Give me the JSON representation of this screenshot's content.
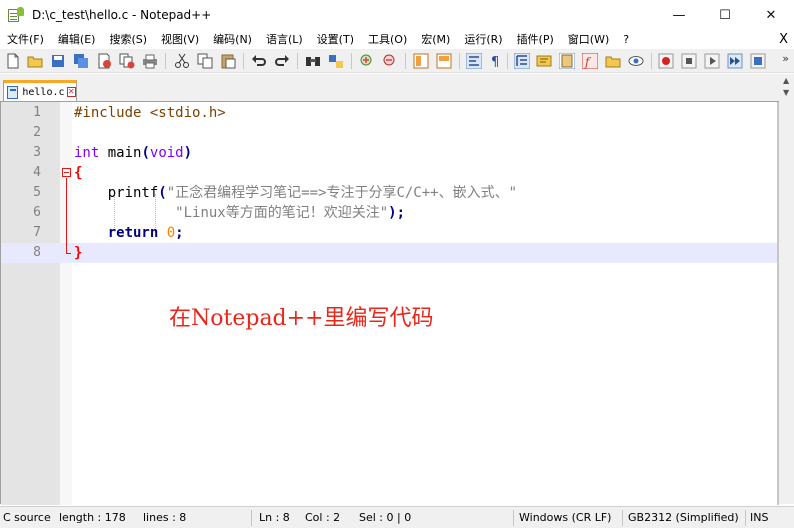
{
  "window": {
    "title": "D:\\c_test\\hello.c - Notepad++",
    "minimize_glyph": "—",
    "maximize_glyph": "☐",
    "close_glyph": "✕"
  },
  "menu": {
    "items": [
      "文件(F)",
      "编辑(E)",
      "搜索(S)",
      "视图(V)",
      "编码(N)",
      "语言(L)",
      "设置(T)",
      "工具(O)",
      "宏(M)",
      "运行(R)",
      "插件(P)",
      "窗口(W)",
      "?"
    ],
    "close_glyph": "X"
  },
  "toolbar": {
    "overflow_glyph": "»",
    "icons": [
      "new-file-icon",
      "open-file-icon",
      "save-icon",
      "save-all-icon",
      "close-icon",
      "close-all-icon",
      "print-icon",
      "cut-icon",
      "copy-icon",
      "paste-icon",
      "undo-icon",
      "redo-icon",
      "find-icon",
      "replace-icon",
      "zoom-in-icon",
      "zoom-out-icon",
      "sync-vertical-icon",
      "sync-horizontal-icon",
      "word-wrap-icon",
      "show-all-chars-icon",
      "indent-guide-icon",
      "udl-icon",
      "doc-map-icon",
      "function-list-icon",
      "folder-workspace-icon",
      "monitor-icon",
      "record-macro-icon",
      "stop-macro-icon",
      "play-macro-icon",
      "run-macro-multiple-icon",
      "save-macro-icon"
    ]
  },
  "tab": {
    "label": "hello.c",
    "close_glyph": "✕"
  },
  "editor": {
    "line_numbers": [
      "1",
      "2",
      "3",
      "4",
      "5",
      "6",
      "7",
      "8"
    ],
    "lines": {
      "l1_pp": "#include <stdio.h>",
      "l3_type": "int",
      "l3_name": " main",
      "l3_open": "(",
      "l3_void": "void",
      "l3_close": ")",
      "l4_brace": "{",
      "l5_indent": "    ",
      "l5_func": "printf",
      "l5_paren": "(",
      "l5_str": "\"正念君编程学习笔记==>专注于分享C/C++、嵌入式、\"",
      "l6_indent": "            ",
      "l6_str": "\"Linux等方面的笔记！欢迎关注\"",
      "l6_close": ");",
      "l7_indent": "    ",
      "l7_kw": "return",
      "l7_num": "0",
      "l7_semi": ";",
      "l8_brace": "}"
    },
    "current_line": 8
  },
  "annotation": {
    "text": "在Notepad++里编写代码",
    "color": "#e8261a"
  },
  "statusbar": {
    "file_type": "C source",
    "length": "length : 178",
    "lines": "lines : 8",
    "ln": "Ln : 8",
    "col": "Col : 2",
    "sel": "Sel : 0 | 0",
    "eol": "Windows (CR LF)",
    "encoding": "GB2312 (Simplified)",
    "mode": "INS"
  }
}
